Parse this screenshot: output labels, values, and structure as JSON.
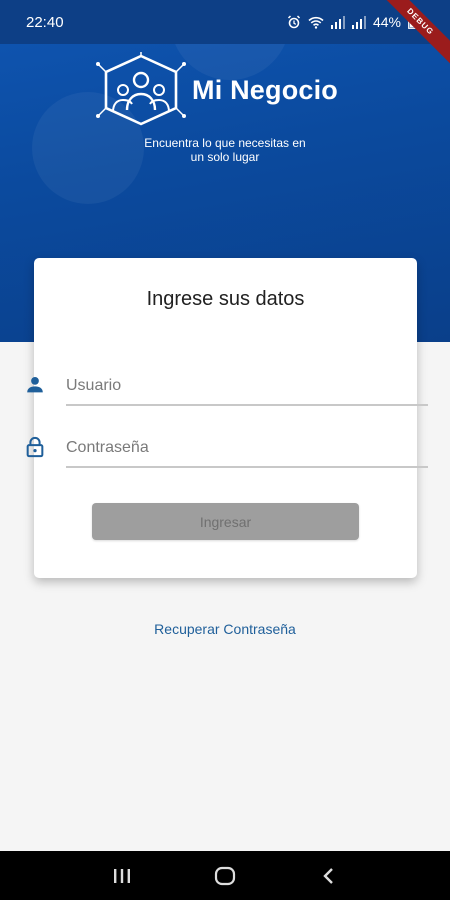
{
  "status_bar": {
    "time": "22:40",
    "battery": "44%",
    "icons": [
      "alarm-icon",
      "wifi-icon",
      "signal-icon",
      "signal-icon",
      "battery-icon"
    ]
  },
  "debug_banner": "DEBUG",
  "brand": {
    "name": "Mi Negocio",
    "tagline_line1": "Encuentra lo que necesitas en",
    "tagline_line2": "un solo lugar",
    "colors": {
      "primary": "#0b4a9e",
      "status_bar": "#0d3f86",
      "icon": "#1f5f9a"
    }
  },
  "login_card": {
    "title": "Ingrese sus datos",
    "username": {
      "placeholder": "Usuario",
      "value": "",
      "icon": "person-icon"
    },
    "password": {
      "placeholder": "Contraseña",
      "value": "",
      "icon": "lock-icon"
    },
    "submit_label": "Ingresar",
    "submit_enabled": false
  },
  "recover_link": "Recuperar Contraseña",
  "system_nav": {
    "buttons": [
      "recents-icon",
      "home-icon",
      "back-icon"
    ]
  }
}
